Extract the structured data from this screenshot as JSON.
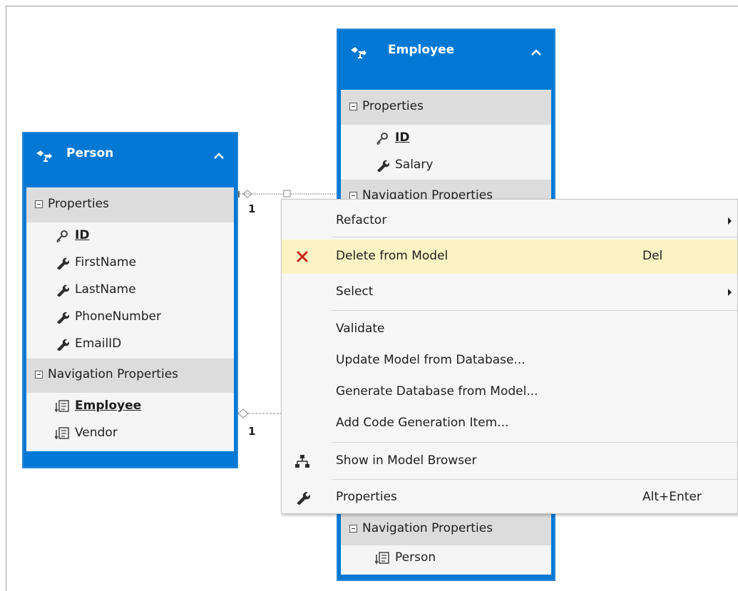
{
  "person": {
    "name": "Person",
    "properties_label": "Properties",
    "properties": [
      "ID",
      "FirstName",
      "LastName",
      "PhoneNumber",
      "EmailID"
    ],
    "nav_label": "Navigation Properties",
    "nav": [
      "Employee",
      "Vendor"
    ]
  },
  "employee": {
    "name": "Employee",
    "properties_label": "Properties",
    "properties": [
      "ID",
      "Salary"
    ],
    "nav_label": "Navigation Properties",
    "nav_label_bottom": "Navigation Properties",
    "nav": [
      "Person"
    ]
  },
  "multiplicity": {
    "top": "1",
    "bottom": "1"
  },
  "menu": {
    "refactor": "Refactor",
    "delete": "Delete from Model",
    "delete_shortcut": "Del",
    "select": "Select",
    "validate": "Validate",
    "update": "Update Model from Database...",
    "generate": "Generate Database from Model...",
    "add_codegen": "Add Code Generation Item...",
    "show_browser": "Show in Model Browser",
    "properties": "Properties",
    "properties_shortcut": "Alt+Enter"
  },
  "colors": {
    "entity_header": "#0078d4",
    "section_bg": "#dcdcdc",
    "highlight": "#fcf3c4",
    "delete_icon": "#c42b1c"
  }
}
